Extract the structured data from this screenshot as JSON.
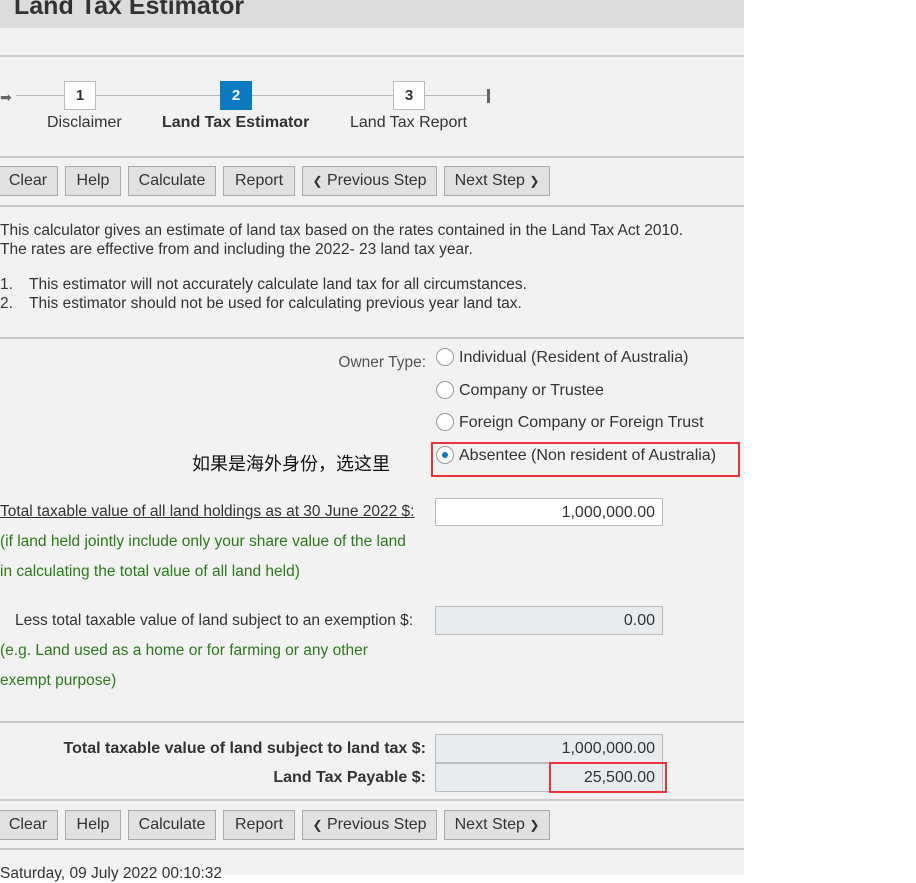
{
  "header": {
    "title": "Land Tax Estimator"
  },
  "steps": [
    {
      "number": "1",
      "label": "Disclaimer"
    },
    {
      "number": "2",
      "label": "Land Tax Estimator",
      "active": true
    },
    {
      "number": "3",
      "label": "Land Tax Report"
    }
  ],
  "toolbar": {
    "clear": "Clear",
    "help": "Help",
    "calculate": "Calculate",
    "report": "Report",
    "previous": "Previous Step",
    "next": "Next Step"
  },
  "intro": {
    "line1": "This calculator gives an estimate of land tax based on the rates contained in the Land Tax Act 2010.",
    "line2": "The rates are effective from and including the 2022- 23 land tax year.",
    "notes": [
      {
        "num": "1.",
        "text": "This estimator will not accurately calculate land tax for all circumstances."
      },
      {
        "num": "2.",
        "text": "This estimator should not be used for calculating previous year land tax."
      }
    ]
  },
  "owner_type": {
    "label": "Owner Type:",
    "options": [
      "Individual (Resident of Australia)",
      "Company or Trustee",
      "Foreign Company or Foreign Trust",
      "Absentee (Non resident of Australia)"
    ],
    "selected": "Absentee (Non resident of Australia)",
    "annotation": "如果是海外身份，选这里"
  },
  "total_value": {
    "label": "Total taxable value of all land holdings as at 30 June 2022 $:",
    "value": "1,000,000.00",
    "hint1": "(if land held jointly include only your share value of the land",
    "hint2": "in calculating the total value of all land held)"
  },
  "exemption": {
    "label": "Less total taxable value of land subject to an exemption $:",
    "value": "0.00",
    "hint1": "(e.g. Land used as a home or for farming or any other",
    "hint2": "exempt purpose)"
  },
  "results": {
    "subject_label": "Total taxable value of land subject to land tax $:",
    "subject_value": "1,000,000.00",
    "payable_label": "Land Tax Payable $:",
    "payable_value": "25,500.00"
  },
  "footer": {
    "timestamp": "Saturday, 09 July 2022 00:10:32"
  },
  "colors": {
    "accent": "#0a7ac2",
    "highlight": "#e8333a",
    "hint": "#2a7a1a"
  }
}
